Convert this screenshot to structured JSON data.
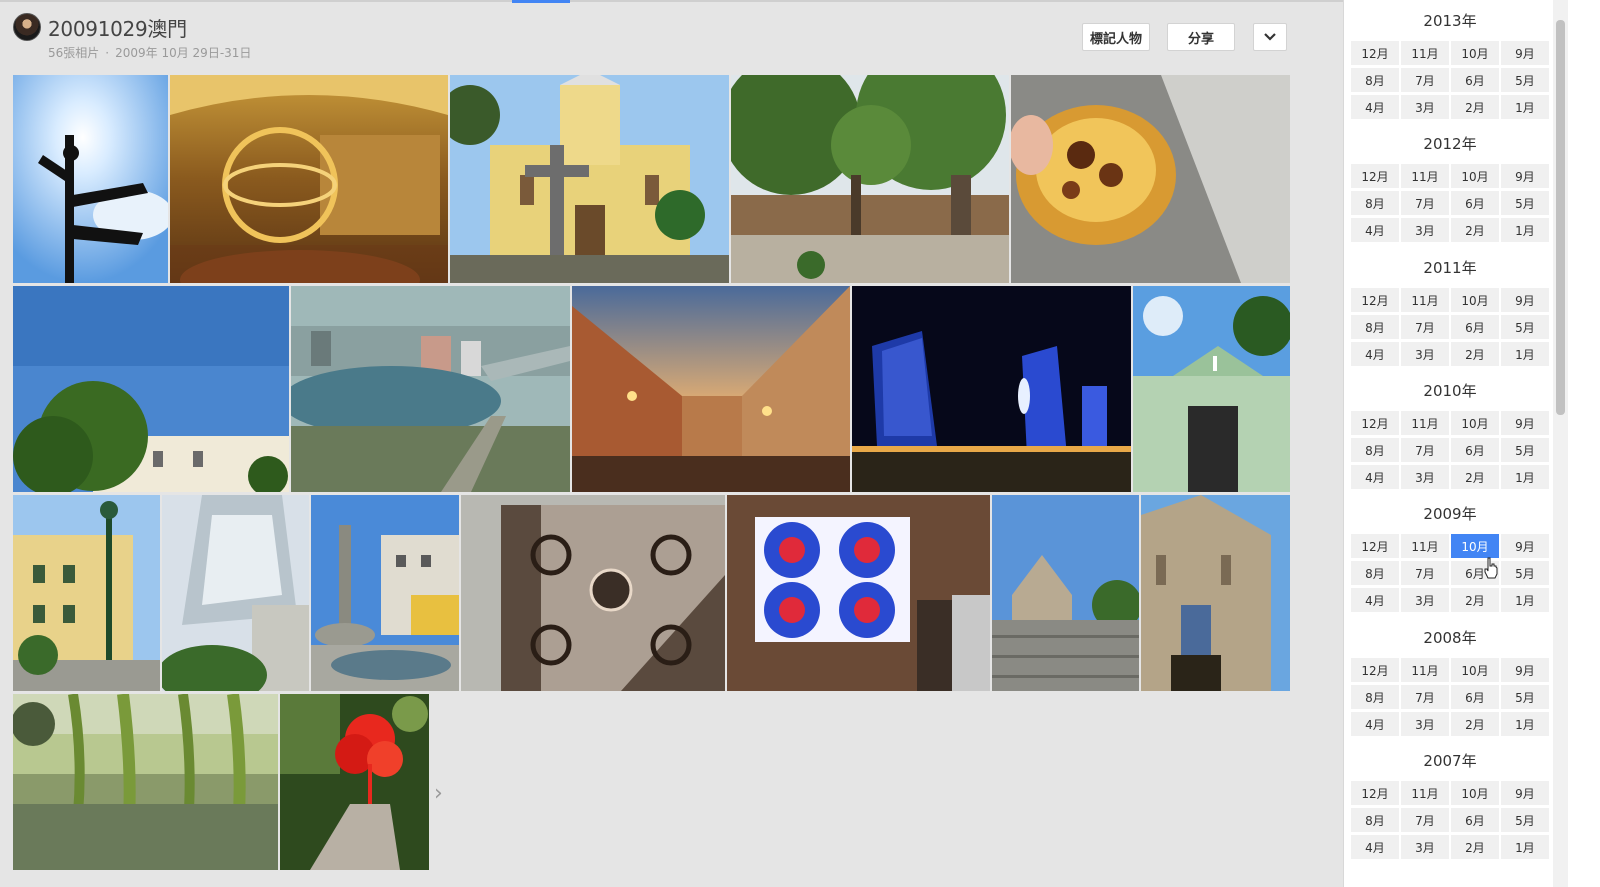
{
  "album": {
    "title": "20091029澳門",
    "photo_count": "56張相片",
    "date_range": "2009年 10月 29日-31日"
  },
  "toolbar": {
    "tag_label": "標記人物",
    "share_label": "分享",
    "more_icon": "chevron-down-icon"
  },
  "colors": {
    "accent": "#4285f4",
    "background": "#e5e5e5"
  },
  "photos": [
    {
      "subject": "signpost against sun"
    },
    {
      "subject": "golden armillary sphere in arcade"
    },
    {
      "subject": "yellow church with cross"
    },
    {
      "subject": "trees over plaza"
    },
    {
      "subject": "egg tart"
    },
    {
      "subject": "tree and building under blue sky"
    },
    {
      "subject": "aerial city bay view"
    },
    {
      "subject": "venetian style street at dusk"
    },
    {
      "subject": "casino towers at night"
    },
    {
      "subject": "green chapel facade"
    },
    {
      "subject": "yellow mansion with lamp post"
    },
    {
      "subject": "crystal tower"
    },
    {
      "subject": "fountain in square"
    },
    {
      "subject": "ornate iron window grille"
    },
    {
      "subject": "stained glass flowers window"
    },
    {
      "subject": "ruins stairway"
    },
    {
      "subject": "ruins facade"
    },
    {
      "subject": "willow pond"
    },
    {
      "subject": "red hibiscus"
    }
  ],
  "sidebar": {
    "years": [
      {
        "year": "2013年",
        "months": [
          "12月",
          "11月",
          "10月",
          "9月",
          "8月",
          "7月",
          "6月",
          "5月",
          "4月",
          "3月",
          "2月",
          "1月"
        ]
      },
      {
        "year": "2012年",
        "months": [
          "12月",
          "11月",
          "10月",
          "9月",
          "8月",
          "7月",
          "6月",
          "5月",
          "4月",
          "3月",
          "2月",
          "1月"
        ]
      },
      {
        "year": "2011年",
        "months": [
          "12月",
          "11月",
          "10月",
          "9月",
          "8月",
          "7月",
          "6月",
          "5月",
          "4月",
          "3月",
          "2月",
          "1月"
        ]
      },
      {
        "year": "2010年",
        "months": [
          "12月",
          "11月",
          "10月",
          "9月",
          "8月",
          "7月",
          "6月",
          "5月",
          "4月",
          "3月",
          "2月",
          "1月"
        ]
      },
      {
        "year": "2009年",
        "months": [
          "12月",
          "11月",
          "10月",
          "9月",
          "8月",
          "7月",
          "6月",
          "5月",
          "4月",
          "3月",
          "2月",
          "1月"
        ],
        "active_month": "10月"
      },
      {
        "year": "2008年",
        "months": [
          "12月",
          "11月",
          "10月",
          "9月",
          "8月",
          "7月",
          "6月",
          "5月",
          "4月",
          "3月",
          "2月",
          "1月"
        ]
      },
      {
        "year": "2007年",
        "months": [
          "12月",
          "11月",
          "10月",
          "9月",
          "8月",
          "7月",
          "6月",
          "5月",
          "4月",
          "3月",
          "2月",
          "1月"
        ]
      }
    ]
  }
}
